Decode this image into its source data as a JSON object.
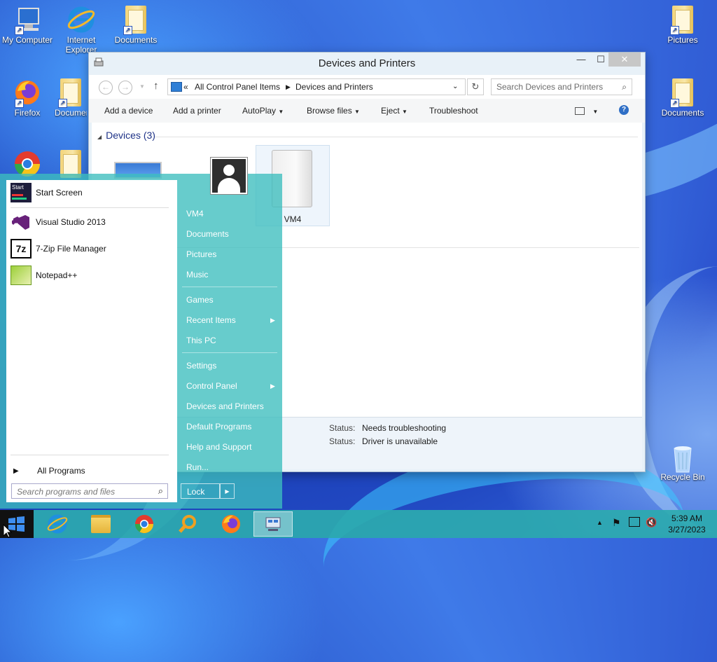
{
  "desktop": {
    "left_icons": [
      {
        "label": "My Computer"
      },
      {
        "label": "Internet Explorer"
      },
      {
        "label": "Documents"
      },
      {
        "label": "Firefox"
      },
      {
        "label": "Documents"
      }
    ],
    "right_icons": [
      {
        "label": "Pictures"
      },
      {
        "label": "Documents"
      },
      {
        "label": "Recycle Bin"
      }
    ]
  },
  "window": {
    "title": "Devices and Printers",
    "minimize": "—",
    "maximize": "☐",
    "close": "✕",
    "address": {
      "prefix": "«",
      "crumbs": [
        "All Control Panel Items",
        "Devices and Printers"
      ]
    },
    "search_placeholder": "Search Devices and Printers",
    "commands": {
      "add_device": "Add a device",
      "add_printer": "Add a printer",
      "autoplay": "AutoPlay",
      "browse_files": "Browse files",
      "eject": "Eject",
      "troubleshoot": "Troubleshoot"
    },
    "devices_group": "Devices (3)",
    "selected_device": "VM4",
    "details": {
      "row1_label": "Status:",
      "row1_value": "Needs troubleshooting",
      "row2_label": "Status:",
      "row2_value": "Driver is unavailable"
    }
  },
  "start_menu": {
    "programs": [
      {
        "label": "Start Screen",
        "icon": "start-screen-icon"
      },
      {
        "label": "Visual Studio 2013",
        "icon": "visual-studio-icon"
      },
      {
        "label": "7-Zip File Manager",
        "icon": "7zip-icon"
      },
      {
        "label": "Notepad++",
        "icon": "notepadpp-icon"
      }
    ],
    "all_programs": "All Programs",
    "search_placeholder": "Search programs and files",
    "right": {
      "user": "VM4",
      "documents": "Documents",
      "pictures": "Pictures",
      "music": "Music",
      "games": "Games",
      "recent": "Recent Items",
      "this_pc": "This PC",
      "settings": "Settings",
      "control_panel": "Control Panel",
      "devices": "Devices and Printers",
      "default_programs": "Default Programs",
      "help": "Help and Support",
      "run": "Run..."
    },
    "lock": "Lock"
  },
  "taskbar": {
    "time": "5:39 AM",
    "date": "3/27/2023"
  }
}
